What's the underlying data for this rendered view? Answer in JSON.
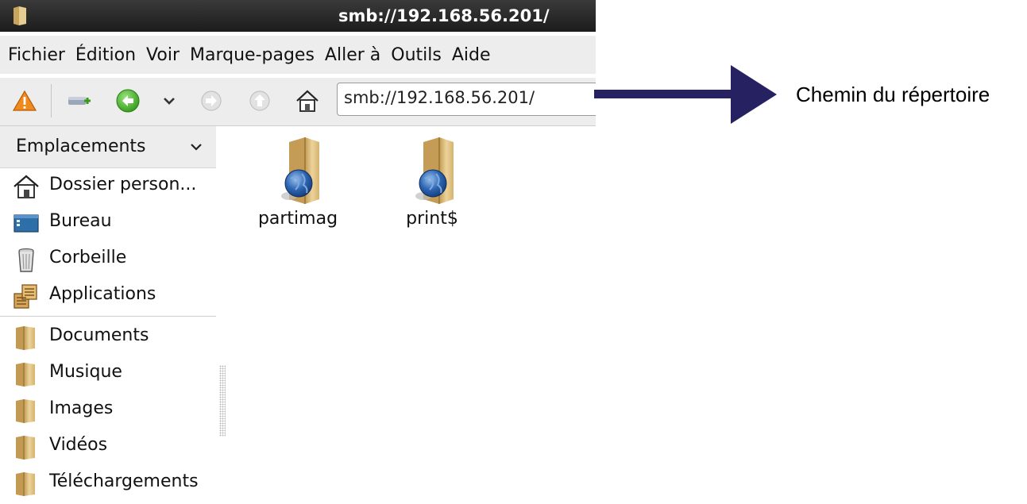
{
  "window": {
    "title": "smb://192.168.56.201/"
  },
  "menu": {
    "items": [
      "Fichier",
      "Édition",
      "Voir",
      "Marque-pages",
      "Aller à",
      "Outils",
      "Aide"
    ]
  },
  "toolbar": {
    "location_value": "smb://192.168.56.201/",
    "icons": [
      "warning-icon",
      "new-tab-icon",
      "back-icon",
      "history-dropdown-icon",
      "forward-icon",
      "up-icon",
      "home-icon"
    ]
  },
  "sidebar": {
    "header_label": "Emplacements",
    "places": [
      {
        "label": "Dossier person...",
        "icon": "home-icon"
      },
      {
        "label": "Bureau",
        "icon": "desktop-icon"
      },
      {
        "label": "Corbeille",
        "icon": "trash-icon"
      },
      {
        "label": "Applications",
        "icon": "applications-icon"
      }
    ],
    "bookmarks": [
      {
        "label": "Documents",
        "icon": "folder-icon"
      },
      {
        "label": "Musique",
        "icon": "folder-icon"
      },
      {
        "label": "Images",
        "icon": "folder-icon"
      },
      {
        "label": "Vidéos",
        "icon": "folder-icon"
      },
      {
        "label": "Téléchargements",
        "icon": "folder-icon"
      }
    ]
  },
  "content": {
    "items": [
      {
        "name": "partimag",
        "icon": "network-share-icon"
      },
      {
        "name": "print$",
        "icon": "network-share-icon"
      }
    ]
  },
  "annotation": {
    "label": "Chemin du répertoire",
    "arrow_color": "#262262"
  }
}
